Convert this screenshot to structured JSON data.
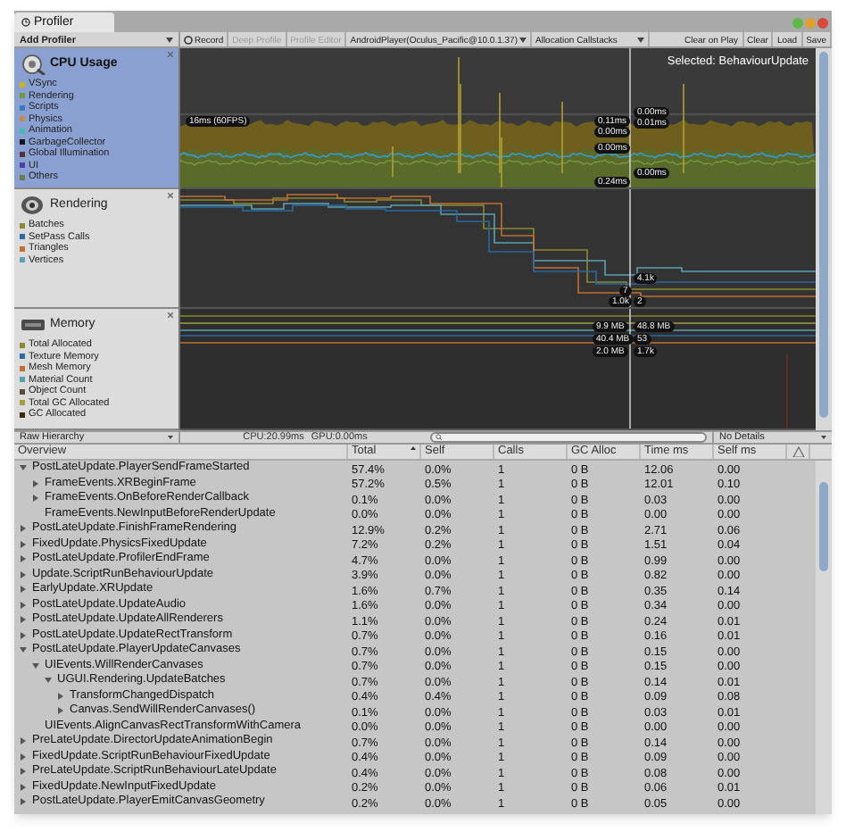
{
  "window": {
    "title": "Profiler"
  },
  "toolbar": {
    "add_profiler": "Add Profiler",
    "buttons": [
      {
        "label": "Record",
        "kind": "record",
        "disabled": false
      },
      {
        "label": "Deep Profile",
        "kind": "plain",
        "disabled": true
      },
      {
        "label": "Profile Editor",
        "kind": "plain",
        "disabled": true
      },
      {
        "label": "AndroidPlayer(Oculus_Pacific@10.0.1.37)",
        "kind": "dropdown",
        "disabled": false
      },
      {
        "label": "Allocation Callstacks",
        "kind": "wide-dropdown",
        "disabled": false
      },
      {
        "label": "Clear on Play",
        "kind": "plain",
        "disabled": false
      },
      {
        "label": "Clear",
        "kind": "plain",
        "disabled": false
      },
      {
        "label": "Load",
        "kind": "plain",
        "disabled": false
      },
      {
        "label": "Save",
        "kind": "plain",
        "disabled": false
      }
    ]
  },
  "modules": [
    {
      "title": "CPU Usage",
      "kind": "cpu",
      "selected": true,
      "legend": [
        {
          "label": "VSync",
          "color": "#c8b428"
        },
        {
          "label": "Rendering",
          "color": "#6e9a3c"
        },
        {
          "label": "Scripts",
          "color": "#3c78c0"
        },
        {
          "label": "Physics",
          "color": "#c08a50"
        },
        {
          "label": "Animation",
          "color": "#46b8b8"
        },
        {
          "label": "GarbageCollector",
          "color": "#101820"
        },
        {
          "label": "Global Illumination",
          "color": "#5a3040"
        },
        {
          "label": "UI",
          "color": "#5040a0"
        },
        {
          "label": "Others",
          "color": "#6a7a48"
        }
      ],
      "graph_labels": [
        "Selected: BehaviourUpdate",
        "16ms (60FPS)",
        "0.11ms",
        "0.00ms",
        "0.00ms",
        "0.24ms",
        "0.00ms",
        "0.01ms",
        "0.00ms"
      ]
    },
    {
      "title": "Rendering",
      "kind": "rendering",
      "selected": false,
      "legend": [
        {
          "label": "Batches",
          "color": "#8a8a30"
        },
        {
          "label": "SetPass Calls",
          "color": "#2a6aa0"
        },
        {
          "label": "Triangles",
          "color": "#c07030"
        },
        {
          "label": "Vertices",
          "color": "#5aa0b0"
        }
      ],
      "graph_labels": [
        "4.1k",
        "7",
        "1.0k",
        "2"
      ]
    },
    {
      "title": "Memory",
      "kind": "memory",
      "selected": false,
      "legend": [
        {
          "label": "Total Allocated",
          "color": "#8a8a30"
        },
        {
          "label": "Texture Memory",
          "color": "#2a6aa0"
        },
        {
          "label": "Mesh Memory",
          "color": "#c07030"
        },
        {
          "label": "Material Count",
          "color": "#5aa0b0"
        },
        {
          "label": "Object Count",
          "color": "#5a4a3a"
        },
        {
          "label": "Total GC Allocated",
          "color": "#a0a040"
        },
        {
          "label": "GC Allocated",
          "color": "#3a2a10"
        }
      ],
      "graph_labels": [
        "9.9 MB",
        "48.8 MB",
        "40.4 MB",
        "53",
        "2.0 MB",
        "1.7k"
      ]
    }
  ],
  "details_bar": {
    "view": "Raw Hierarchy",
    "cpu": "CPU:20.99ms",
    "gpu": "GPU:0.00ms",
    "details": "No Details"
  },
  "table": {
    "columns": [
      {
        "label": "Overview",
        "sorted": false
      },
      {
        "label": "Total",
        "sorted": true
      },
      {
        "label": "Self",
        "sorted": false
      },
      {
        "label": "Calls",
        "sorted": false
      },
      {
        "label": "GC Alloc",
        "sorted": false
      },
      {
        "label": "Time ms",
        "sorted": false
      },
      {
        "label": "Self ms",
        "sorted": false
      }
    ],
    "rows": [
      {
        "name": "PostLateUpdate.PlayerSendFrameStarted",
        "values": [
          "57.4%",
          "0.0%",
          "1",
          "0 B",
          "12.06",
          "0.00"
        ],
        "expanded": true,
        "children": [
          {
            "name": "FrameEvents.XRBeginFrame",
            "values": [
              "57.2%",
              "0.5%",
              "1",
              "0 B",
              "12.01",
              "0.10"
            ],
            "expanded": false
          },
          {
            "name": "FrameEvents.OnBeforeRenderCallback",
            "values": [
              "0.1%",
              "0.0%",
              "1",
              "0 B",
              "0.03",
              "0.00"
            ],
            "expanded": false
          },
          {
            "name": "FrameEvents.NewInputBeforeRenderUpdate",
            "values": [
              "0.0%",
              "0.0%",
              "1",
              "0 B",
              "0.00",
              "0.00"
            ]
          }
        ]
      },
      {
        "name": "PostLateUpdate.FinishFrameRendering",
        "values": [
          "12.9%",
          "0.2%",
          "1",
          "0 B",
          "2.71",
          "0.06"
        ],
        "expanded": false
      },
      {
        "name": "FixedUpdate.PhysicsFixedUpdate",
        "values": [
          "7.2%",
          "0.2%",
          "1",
          "0 B",
          "1.51",
          "0.04"
        ],
        "expanded": false
      },
      {
        "name": "PostLateUpdate.ProfilerEndFrame",
        "values": [
          "4.7%",
          "0.0%",
          "1",
          "0 B",
          "0.99",
          "0.00"
        ],
        "expanded": false
      },
      {
        "name": "Update.ScriptRunBehaviourUpdate",
        "values": [
          "3.9%",
          "0.0%",
          "1",
          "0 B",
          "0.82",
          "0.00"
        ],
        "expanded": false
      },
      {
        "name": "EarlyUpdate.XRUpdate",
        "values": [
          "1.6%",
          "0.7%",
          "1",
          "0 B",
          "0.35",
          "0.14"
        ],
        "expanded": false
      },
      {
        "name": "PostLateUpdate.UpdateAudio",
        "values": [
          "1.6%",
          "0.0%",
          "1",
          "0 B",
          "0.34",
          "0.00"
        ],
        "expanded": false
      },
      {
        "name": "PostLateUpdate.UpdateAllRenderers",
        "values": [
          "1.1%",
          "0.0%",
          "1",
          "0 B",
          "0.24",
          "0.01"
        ],
        "expanded": false
      },
      {
        "name": "PostLateUpdate.UpdateRectTransform",
        "values": [
          "0.7%",
          "0.0%",
          "1",
          "0 B",
          "0.16",
          "0.01"
        ],
        "expanded": false
      },
      {
        "name": "PostLateUpdate.PlayerUpdateCanvases",
        "values": [
          "0.7%",
          "0.0%",
          "1",
          "0 B",
          "0.15",
          "0.00"
        ],
        "expanded": true,
        "children": [
          {
            "name": "UIEvents.WillRenderCanvases",
            "values": [
              "0.7%",
              "0.0%",
              "1",
              "0 B",
              "0.15",
              "0.00"
            ],
            "expanded": true,
            "children": [
              {
                "name": "UGUI.Rendering.UpdateBatches",
                "values": [
                  "0.7%",
                  "0.0%",
                  "1",
                  "0 B",
                  "0.14",
                  "0.01"
                ],
                "expanded": true,
                "children": [
                  {
                    "name": "TransformChangedDispatch",
                    "values": [
                      "0.4%",
                      "0.4%",
                      "1",
                      "0 B",
                      "0.09",
                      "0.08"
                    ],
                    "expanded": false
                  },
                  {
                    "name": "Canvas.SendWillRenderCanvases()",
                    "values": [
                      "0.1%",
                      "0.0%",
                      "1",
                      "0 B",
                      "0.03",
                      "0.01"
                    ],
                    "expanded": false
                  }
                ]
              }
            ]
          },
          {
            "name": "UIEvents.AlignCanvasRectTransformWithCamera",
            "values": [
              "0.0%",
              "0.0%",
              "1",
              "0 B",
              "0.00",
              "0.00"
            ]
          }
        ]
      },
      {
        "name": "PreLateUpdate.DirectorUpdateAnimationBegin",
        "values": [
          "0.7%",
          "0.0%",
          "1",
          "0 B",
          "0.14",
          "0.00"
        ],
        "expanded": false
      },
      {
        "name": "FixedUpdate.ScriptRunBehaviourFixedUpdate",
        "values": [
          "0.4%",
          "0.0%",
          "1",
          "0 B",
          "0.09",
          "0.00"
        ],
        "expanded": false
      },
      {
        "name": "PreLateUpdate.ScriptRunBehaviourLateUpdate",
        "values": [
          "0.4%",
          "0.0%",
          "1",
          "0 B",
          "0.08",
          "0.00"
        ],
        "expanded": false
      },
      {
        "name": "FixedUpdate.NewInputFixedUpdate",
        "values": [
          "0.2%",
          "0.0%",
          "1",
          "0 B",
          "0.06",
          "0.01"
        ],
        "expanded": false
      },
      {
        "name": "PostLateUpdate.PlayerEmitCanvasGeometry",
        "values": [
          "0.2%",
          "0.0%",
          "1",
          "0 B",
          "0.05",
          "0.00"
        ],
        "expanded": false
      }
    ]
  }
}
